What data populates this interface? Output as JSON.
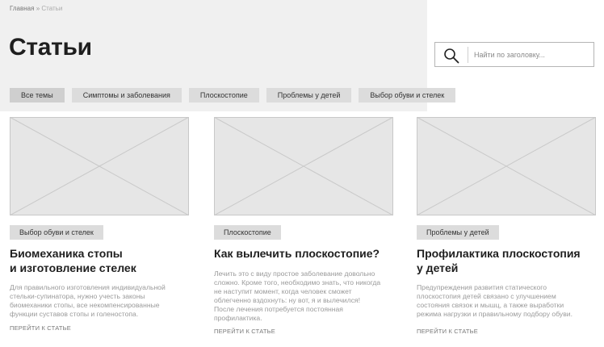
{
  "breadcrumb": {
    "home": "Главная",
    "separator": "»",
    "current": "Статьи"
  },
  "page_title": "Статьи",
  "search": {
    "placeholder": "Найти по заголовку..."
  },
  "filters": [
    "Все темы",
    "Симптомы и заболевания",
    "Плоскостопие",
    "Проблемы у детей",
    "Выбор обуви и стелек"
  ],
  "cards": [
    {
      "tag": "Выбор обуви и стелек",
      "title_lines": [
        "Биомеханика стопы",
        "и изготовление стелек"
      ],
      "text_lines": [
        "Для правильного изготовления индивидуальной",
        "стельки-супинатора, нужно учесть законы",
        "биомеханики стопы, все некомпенсированные",
        "функции суставов стопы и голеностопа."
      ],
      "link": "ПЕРЕЙТИ К СТАТЬЕ"
    },
    {
      "tag": "Плоскостопие",
      "title_lines": [
        "Как вылечить плоскостопие?"
      ],
      "text_lines": [
        "Лечить это с виду простое заболевание довольно",
        "сложно. Кроме того, необходимо знать, что никогда",
        "не наступит момент, когда человек сможет",
        "облегченно вздохнуть: ну вот, я и вылечился!",
        "После лечения потребуется постоянная",
        "профилактика."
      ],
      "link": "ПЕРЕЙТИ К СТАТЬЕ"
    },
    {
      "tag": "Проблемы у детей",
      "title_lines": [
        "Профилактика плоскостопия",
        "у детей"
      ],
      "text_lines": [
        "Предупреждения развития статического",
        "плоскостопия детей связано с улучшением",
        "состояния связок и мышц, а также выработки",
        "режима нагрузки и правильному подбору обуви."
      ],
      "link": "ПЕРЕЙТИ К СТАТЬЕ"
    }
  ]
}
